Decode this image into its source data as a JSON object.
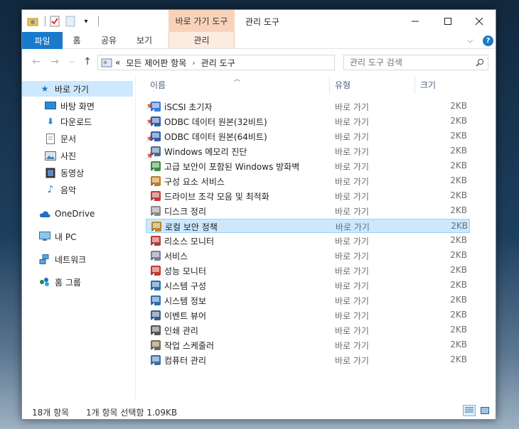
{
  "titlebar": {
    "context_tab": "바로 가기 도구",
    "title": "관리 도구",
    "minimize_icon": "minimize-icon",
    "maximize_icon": "maximize-icon",
    "close_icon": "close-icon"
  },
  "ribbon": {
    "tabs": [
      "파일",
      "홈",
      "공유",
      "보기"
    ],
    "manage_tab": "관리"
  },
  "address": {
    "overflow": "«",
    "crumbs": [
      "모든 제어판 항목",
      "관리 도구"
    ],
    "search_placeholder": "관리 도구 검색"
  },
  "nav": {
    "quick_access": "바로 가기",
    "pinned": [
      "바탕 화면",
      "다운로드",
      "문서",
      "사진"
    ],
    "libraries": [
      "동영상",
      "음악"
    ],
    "onedrive": "OneDrive",
    "this_pc": "내 PC",
    "network": "네트워크",
    "homegroup": "홈 그룹"
  },
  "columns": {
    "name": "이름",
    "type": "유형",
    "size": "크기"
  },
  "files": [
    {
      "name": "iSCSI 초기자",
      "type": "바로 가기",
      "size": "2KB",
      "icon": "iscsi-icon",
      "color": "#3a7bd5"
    },
    {
      "name": "ODBC 데이터 원본(32비트)",
      "type": "바로 가기",
      "size": "2KB",
      "icon": "odbc-icon",
      "color": "#2a5ea8"
    },
    {
      "name": "ODBC 데이터 원본(64비트)",
      "type": "바로 가기",
      "size": "2KB",
      "icon": "odbc-icon",
      "color": "#2a5ea8"
    },
    {
      "name": "Windows 메모리 진단",
      "type": "바로 가기",
      "size": "2KB",
      "icon": "memory-diagnostic-icon",
      "color": "#4a6b8a"
    },
    {
      "name": "고급 보안이 포함된 Windows 방화벽",
      "type": "바로 가기",
      "size": "2KB",
      "icon": "firewall-icon",
      "color": "#3c8d3c"
    },
    {
      "name": "구성 요소 서비스",
      "type": "바로 가기",
      "size": "2KB",
      "icon": "component-services-icon",
      "color": "#c07a1e"
    },
    {
      "name": "드라이브 조각 모음 및 최적화",
      "type": "바로 가기",
      "size": "2KB",
      "icon": "defrag-icon",
      "color": "#c23b3b"
    },
    {
      "name": "디스크 정리",
      "type": "바로 가기",
      "size": "2KB",
      "icon": "disk-cleanup-icon",
      "color": "#8a8a8a"
    },
    {
      "name": "로컬 보안 정책",
      "type": "바로 가기",
      "size": "2KB",
      "icon": "security-policy-icon",
      "color": "#b8862b"
    },
    {
      "name": "리소스 모니터",
      "type": "바로 가기",
      "size": "2KB",
      "icon": "resource-monitor-icon",
      "color": "#b83a3a"
    },
    {
      "name": "서비스",
      "type": "바로 가기",
      "size": "2KB",
      "icon": "services-icon",
      "color": "#7a7a9a"
    },
    {
      "name": "성능 모니터",
      "type": "바로 가기",
      "size": "2KB",
      "icon": "performance-monitor-icon",
      "color": "#c0392b"
    },
    {
      "name": "시스템 구성",
      "type": "바로 가기",
      "size": "2KB",
      "icon": "system-config-icon",
      "color": "#2e6fb0"
    },
    {
      "name": "시스템 정보",
      "type": "바로 가기",
      "size": "2KB",
      "icon": "system-info-icon",
      "color": "#2e6fb0"
    },
    {
      "name": "이벤트 뷰어",
      "type": "바로 가기",
      "size": "2KB",
      "icon": "event-viewer-icon",
      "color": "#3a5f8a"
    },
    {
      "name": "인쇄 관리",
      "type": "바로 가기",
      "size": "2KB",
      "icon": "print-management-icon",
      "color": "#555555"
    },
    {
      "name": "작업 스케줄러",
      "type": "바로 가기",
      "size": "2KB",
      "icon": "task-scheduler-icon",
      "color": "#7a6a4a"
    },
    {
      "name": "컴퓨터 관리",
      "type": "바로 가기",
      "size": "2KB",
      "icon": "computer-management-icon",
      "color": "#3a6fa8"
    }
  ],
  "selected_row": 8,
  "status": {
    "count": "18개 항목",
    "selection": "1개 항목 선택함 1.09KB"
  },
  "colors": {
    "accent": "#1979ca",
    "selection": "#cce8ff",
    "context_tab": "#f9d3b9"
  }
}
